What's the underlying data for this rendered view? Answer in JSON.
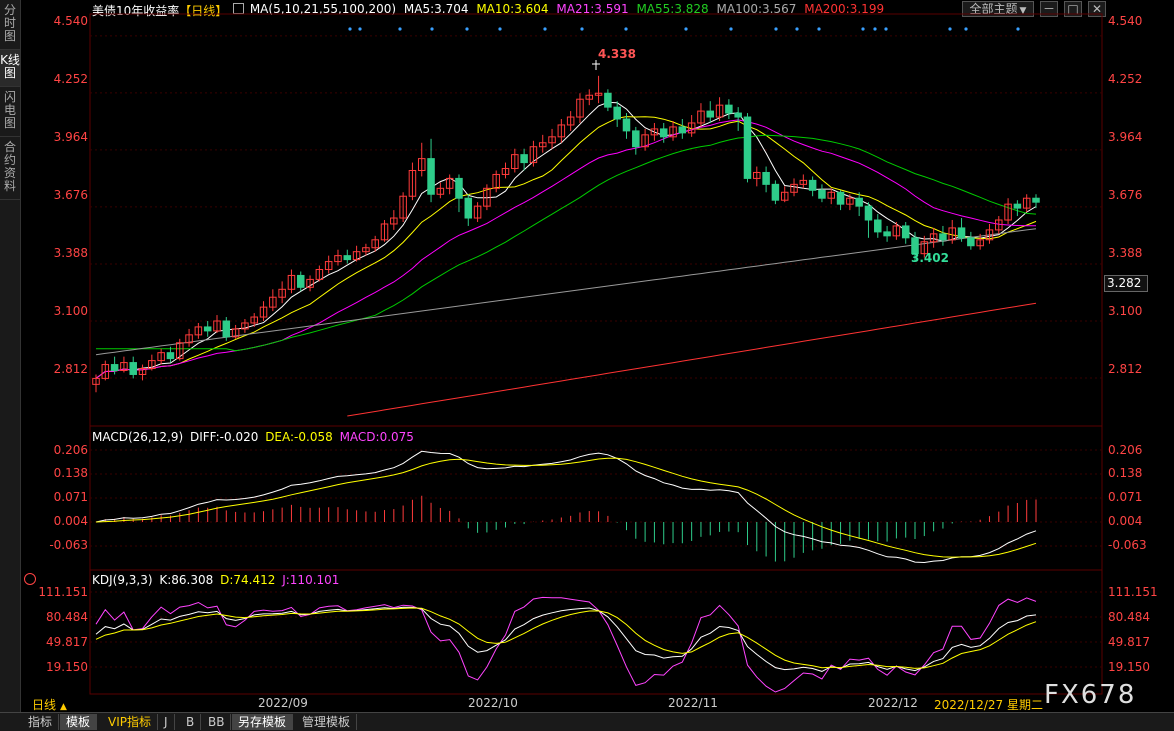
{
  "sidebar": {
    "tabs": [
      {
        "label": "分时图"
      },
      {
        "label": "K线图"
      },
      {
        "label": "闪电图"
      },
      {
        "label": "合约资料"
      }
    ]
  },
  "header": {
    "title": "美债10年收益率",
    "period_tag": "【日线】",
    "ma_params": "MA(5,10,21,55,100,200)",
    "ma5": "MA5:3.704",
    "ma10": "MA10:3.604",
    "ma21": "MA21:3.591",
    "ma55": "MA55:3.828",
    "ma100": "MA100:3.567",
    "ma200": "MA200:3.199",
    "theme_button": "全部主题",
    "colors": {
      "ma5": "#ffffff",
      "ma10": "#ffff00",
      "ma21": "#ff00ff",
      "ma55": "#00cc00",
      "ma100": "#999999",
      "ma200": "#ff3333"
    }
  },
  "price_axis": {
    "ticks": [
      "4.540",
      "4.252",
      "3.964",
      "3.676",
      "3.388",
      "3.100",
      "2.812"
    ],
    "current_value": "3.282",
    "high_label": "4.338",
    "low_label": "3.402"
  },
  "macd": {
    "title": "MACD(26,12,9)",
    "diff": "DIFF:-0.020",
    "dea": "DEA:-0.058",
    "macd": "MACD:0.075",
    "ticks": [
      "0.206",
      "0.138",
      "0.071",
      "0.004",
      "-0.063"
    ]
  },
  "kdj": {
    "title": "KDJ(9,3,3)",
    "k": "K:86.308",
    "d": "D:74.412",
    "j": "J:110.101",
    "ticks": [
      "111.151",
      "80.484",
      "49.817",
      "19.150"
    ]
  },
  "x_axis": {
    "labels": [
      "2022/09",
      "2022/10",
      "2022/11",
      "2022/12"
    ],
    "cursor_date": "2022/12/27 星期二"
  },
  "bottom": {
    "period_select": "日线",
    "tabs": [
      "指标",
      "模板",
      "VIP指标",
      "J",
      "B",
      "BB",
      "另存模板",
      "管理模板"
    ]
  },
  "watermark": "FX678",
  "chart_data": {
    "type": "candlestick",
    "price_range": [
      2.6,
      4.62
    ],
    "candles": [
      [
        2.78,
        2.81,
        2.74,
        2.83
      ],
      [
        2.81,
        2.88,
        2.8,
        2.9
      ],
      [
        2.88,
        2.85,
        2.83,
        2.92
      ],
      [
        2.85,
        2.89,
        2.84,
        2.92
      ],
      [
        2.89,
        2.83,
        2.81,
        2.92
      ],
      [
        2.83,
        2.86,
        2.8,
        2.88
      ],
      [
        2.86,
        2.9,
        2.85,
        2.93
      ],
      [
        2.9,
        2.94,
        2.88,
        2.96
      ],
      [
        2.94,
        2.91,
        2.89,
        2.97
      ],
      [
        2.91,
        2.99,
        2.9,
        3.01
      ],
      [
        2.99,
        3.03,
        2.97,
        3.06
      ],
      [
        3.03,
        3.07,
        3.01,
        3.09
      ],
      [
        3.07,
        3.05,
        3.02,
        3.1
      ],
      [
        3.05,
        3.1,
        3.04,
        3.13
      ],
      [
        3.1,
        3.02,
        3.0,
        3.12
      ],
      [
        3.02,
        3.06,
        3.01,
        3.08
      ],
      [
        3.06,
        3.09,
        3.04,
        3.11
      ],
      [
        3.09,
        3.12,
        3.07,
        3.14
      ],
      [
        3.12,
        3.17,
        3.1,
        3.2
      ],
      [
        3.17,
        3.22,
        3.15,
        3.26
      ],
      [
        3.22,
        3.26,
        3.19,
        3.3
      ],
      [
        3.26,
        3.33,
        3.24,
        3.36
      ],
      [
        3.33,
        3.27,
        3.25,
        3.35
      ],
      [
        3.27,
        3.31,
        3.25,
        3.33
      ],
      [
        3.31,
        3.36,
        3.3,
        3.38
      ],
      [
        3.36,
        3.4,
        3.34,
        3.43
      ],
      [
        3.4,
        3.43,
        3.38,
        3.46
      ],
      [
        3.43,
        3.41,
        3.39,
        3.46
      ],
      [
        3.41,
        3.45,
        3.4,
        3.48
      ],
      [
        3.45,
        3.47,
        3.43,
        3.49
      ],
      [
        3.47,
        3.51,
        3.45,
        3.53
      ],
      [
        3.51,
        3.59,
        3.5,
        3.61
      ],
      [
        3.59,
        3.62,
        3.56,
        3.66
      ],
      [
        3.62,
        3.73,
        3.6,
        3.75
      ],
      [
        3.73,
        3.86,
        3.71,
        3.9
      ],
      [
        3.86,
        3.92,
        3.83,
        4.0
      ],
      [
        3.92,
        3.74,
        3.7,
        4.02
      ],
      [
        3.74,
        3.77,
        3.72,
        3.8
      ],
      [
        3.77,
        3.82,
        3.74,
        3.84
      ],
      [
        3.82,
        3.72,
        3.65,
        3.84
      ],
      [
        3.72,
        3.62,
        3.58,
        3.74
      ],
      [
        3.62,
        3.68,
        3.6,
        3.7
      ],
      [
        3.68,
        3.77,
        3.66,
        3.79
      ],
      [
        3.77,
        3.84,
        3.75,
        3.86
      ],
      [
        3.84,
        3.87,
        3.82,
        3.9
      ],
      [
        3.87,
        3.94,
        3.85,
        3.97
      ],
      [
        3.94,
        3.9,
        3.86,
        3.97
      ],
      [
        3.9,
        3.98,
        3.88,
        4.01
      ],
      [
        3.98,
        4.0,
        3.95,
        4.04
      ],
      [
        4.0,
        4.03,
        3.97,
        4.07
      ],
      [
        4.03,
        4.09,
        4.0,
        4.12
      ],
      [
        4.09,
        4.13,
        4.06,
        4.16
      ],
      [
        4.13,
        4.22,
        4.1,
        4.25
      ],
      [
        4.22,
        4.24,
        4.19,
        4.27
      ],
      [
        4.24,
        4.25,
        4.2,
        4.338
      ],
      [
        4.25,
        4.18,
        4.16,
        4.27
      ],
      [
        4.18,
        4.12,
        4.08,
        4.21
      ],
      [
        4.12,
        4.06,
        4.02,
        4.15
      ],
      [
        4.06,
        3.98,
        3.94,
        4.08
      ],
      [
        3.98,
        4.04,
        3.96,
        4.07
      ],
      [
        4.04,
        4.07,
        4.01,
        4.1
      ],
      [
        4.07,
        4.03,
        4.0,
        4.1
      ],
      [
        4.03,
        4.08,
        4.01,
        4.11
      ],
      [
        4.08,
        4.05,
        4.02,
        4.12
      ],
      [
        4.05,
        4.1,
        4.03,
        4.14
      ],
      [
        4.1,
        4.16,
        4.08,
        4.2
      ],
      [
        4.16,
        4.13,
        4.1,
        4.21
      ],
      [
        4.13,
        4.19,
        4.11,
        4.23
      ],
      [
        4.19,
        4.15,
        4.12,
        4.22
      ],
      [
        4.15,
        4.13,
        4.06,
        4.18
      ],
      [
        4.13,
        3.82,
        3.8,
        4.15
      ],
      [
        3.82,
        3.85,
        3.78,
        3.88
      ],
      [
        3.85,
        3.79,
        3.75,
        3.88
      ],
      [
        3.79,
        3.71,
        3.69,
        3.81
      ],
      [
        3.71,
        3.75,
        3.7,
        3.78
      ],
      [
        3.75,
        3.79,
        3.73,
        3.82
      ],
      [
        3.79,
        3.81,
        3.77,
        3.84
      ],
      [
        3.81,
        3.76,
        3.73,
        3.83
      ],
      [
        3.76,
        3.72,
        3.7,
        3.79
      ],
      [
        3.72,
        3.75,
        3.69,
        3.77
      ],
      [
        3.75,
        3.69,
        3.66,
        3.76
      ],
      [
        3.69,
        3.72,
        3.66,
        3.74
      ],
      [
        3.72,
        3.68,
        3.63,
        3.75
      ],
      [
        3.68,
        3.61,
        3.52,
        3.7
      ],
      [
        3.61,
        3.55,
        3.52,
        3.64
      ],
      [
        3.55,
        3.53,
        3.5,
        3.58
      ],
      [
        3.53,
        3.58,
        3.51,
        3.6
      ],
      [
        3.58,
        3.52,
        3.49,
        3.6
      ],
      [
        3.52,
        3.44,
        3.402,
        3.55
      ],
      [
        3.44,
        3.5,
        3.42,
        3.53
      ],
      [
        3.5,
        3.54,
        3.47,
        3.57
      ],
      [
        3.54,
        3.51,
        3.48,
        3.58
      ],
      [
        3.51,
        3.57,
        3.49,
        3.61
      ],
      [
        3.57,
        3.52,
        3.5,
        3.62
      ],
      [
        3.52,
        3.48,
        3.46,
        3.55
      ],
      [
        3.48,
        3.51,
        3.46,
        3.54
      ],
      [
        3.51,
        3.56,
        3.49,
        3.59
      ],
      [
        3.56,
        3.61,
        3.54,
        3.63
      ],
      [
        3.61,
        3.69,
        3.59,
        3.72
      ],
      [
        3.69,
        3.67,
        3.63,
        3.71
      ],
      [
        3.67,
        3.72,
        3.65,
        3.74
      ],
      [
        3.72,
        3.7,
        3.67,
        3.74
      ]
    ]
  }
}
